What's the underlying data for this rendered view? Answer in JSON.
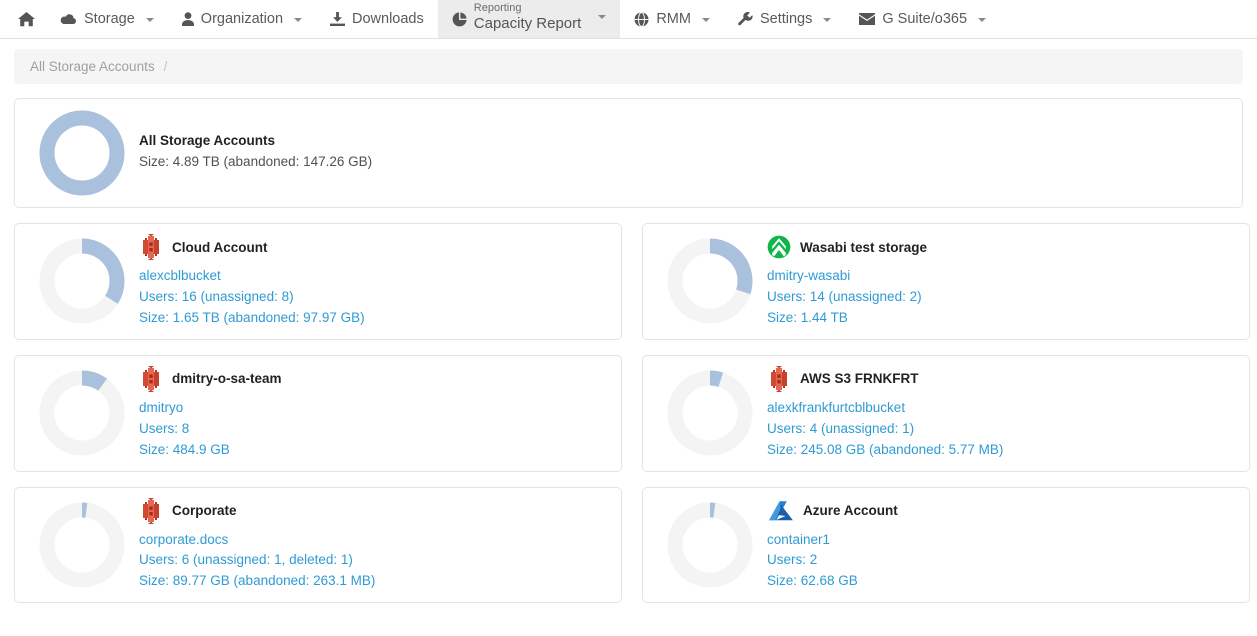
{
  "navbar": {
    "home_icon": "home-icon",
    "items": [
      {
        "label": "Storage",
        "icon": "cloud-icon",
        "caret": true,
        "active": false
      },
      {
        "label": "Organization",
        "icon": "user-icon",
        "caret": true,
        "active": false
      },
      {
        "label": "Downloads",
        "icon": "download-icon",
        "caret": false,
        "active": false
      },
      {
        "label": "RMM",
        "icon": "globe-icon",
        "caret": true,
        "active": false
      },
      {
        "label": "Settings",
        "icon": "wrench-icon",
        "caret": true,
        "active": false
      },
      {
        "label": "G Suite/o365",
        "icon": "envelope-icon",
        "caret": true,
        "active": false
      }
    ],
    "active_tab": {
      "sub_label": "Reporting",
      "main_label": "Capacity Report",
      "icon": "pie-chart-icon",
      "caret": true
    }
  },
  "breadcrumb": {
    "items": [
      "All Storage Accounts"
    ],
    "separator": "/"
  },
  "colors": {
    "donut_fill": "#a9c1dd",
    "donut_track": "#f4f4f4",
    "link": "#2f9bd4",
    "aws_red": "#c9412e",
    "wasabi_green": "#0eb54a",
    "azure_blue": "#1e6fbd"
  },
  "summary_card": {
    "title": "All Storage Accounts",
    "size_line": "Size: 4.89 TB (abandoned: 147.26 GB)",
    "percent": 100
  },
  "accounts": [
    {
      "title": "Cloud Account",
      "icon": "aws-s3-bucket-icon",
      "bucket": "alexcblbucket",
      "users_line": "Users: 16 (unassigned: 8)",
      "size_line": "Size: 1.65 TB (abandoned: 97.97 GB)",
      "percent": 34
    },
    {
      "title": "Wasabi test storage",
      "icon": "wasabi-icon",
      "bucket": "dmitry-wasabi",
      "users_line": "Users: 14 (unassigned: 2)",
      "size_line": "Size: 1.44 TB",
      "percent": 30
    },
    {
      "title": "dmitry-o-sa-team",
      "icon": "aws-s3-bucket-icon",
      "bucket": "dmitryo",
      "users_line": "Users: 8",
      "size_line": "Size: 484.9 GB",
      "percent": 10
    },
    {
      "title": "AWS S3 FRNKFRT",
      "icon": "aws-s3-bucket-icon",
      "bucket": "alexkfrankfurtcblbucket",
      "users_line": "Users: 4 (unassigned: 1)",
      "size_line": "Size: 245.08 GB (abandoned: 5.77 MB)",
      "percent": 5
    },
    {
      "title": "Corporate",
      "icon": "aws-s3-bucket-icon",
      "bucket": "corporate.docs",
      "users_line": "Users: 6 (unassigned: 1, deleted: 1)",
      "size_line": "Size: 89.77 GB (abandoned: 263.1 MB)",
      "percent": 2
    },
    {
      "title": "Azure Account",
      "icon": "azure-icon",
      "bucket": "container1",
      "users_line": "Users: 2",
      "size_line": "Size: 62.68 GB",
      "percent": 2
    }
  ],
  "chart_data": {
    "type": "pie",
    "title": "Storage capacity per account (donut gauges)",
    "series": [
      {
        "name": "All Storage Accounts",
        "percent": 100,
        "size": "4.89 TB",
        "abandoned": "147.26 GB"
      },
      {
        "name": "Cloud Account",
        "percent": 34,
        "size": "1.65 TB",
        "abandoned": "97.97 GB"
      },
      {
        "name": "Wasabi test storage",
        "percent": 30,
        "size": "1.44 TB",
        "abandoned": null
      },
      {
        "name": "dmitry-o-sa-team",
        "percent": 10,
        "size": "484.9 GB",
        "abandoned": null
      },
      {
        "name": "AWS S3 FRNKFRT",
        "percent": 5,
        "size": "245.08 GB",
        "abandoned": "5.77 MB"
      },
      {
        "name": "Corporate",
        "percent": 2,
        "size": "89.77 GB",
        "abandoned": "263.1 MB"
      },
      {
        "name": "Azure Account",
        "percent": 2,
        "size": "62.68 GB",
        "abandoned": null
      }
    ],
    "legend": "none",
    "grid": false
  }
}
